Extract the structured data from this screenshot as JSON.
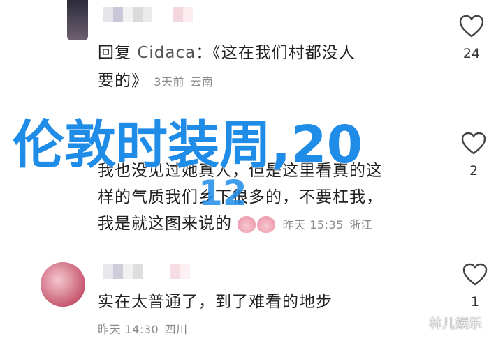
{
  "comments": [
    {
      "prefix": "回复",
      "reply_to": "Cidaca",
      "text_line1": "：《这在我们村都没人",
      "text_line2": "要的》",
      "time": "3天前",
      "location": "云南",
      "likes": "24"
    },
    {
      "text_line1": "我也没见过她真人，但是这里看真的这",
      "text_line2": "样的气质我们乡下很多的，不要杠我，",
      "text_line3": "我是就这图来说的",
      "time": "昨天 15:35",
      "location": "浙江",
      "likes": "2"
    },
    {
      "text_line1": "实在太普通了，到了难看的地步",
      "time": "昨天 14:30",
      "location": "四川",
      "likes": "1"
    }
  ],
  "watermark": {
    "title": "伦敦时装周,20",
    "title_suffix": "12"
  },
  "corner_mark": "林儿娱乐",
  "colors": {
    "watermark": "#1f8de8",
    "meta_text": "#8a8a8a"
  }
}
